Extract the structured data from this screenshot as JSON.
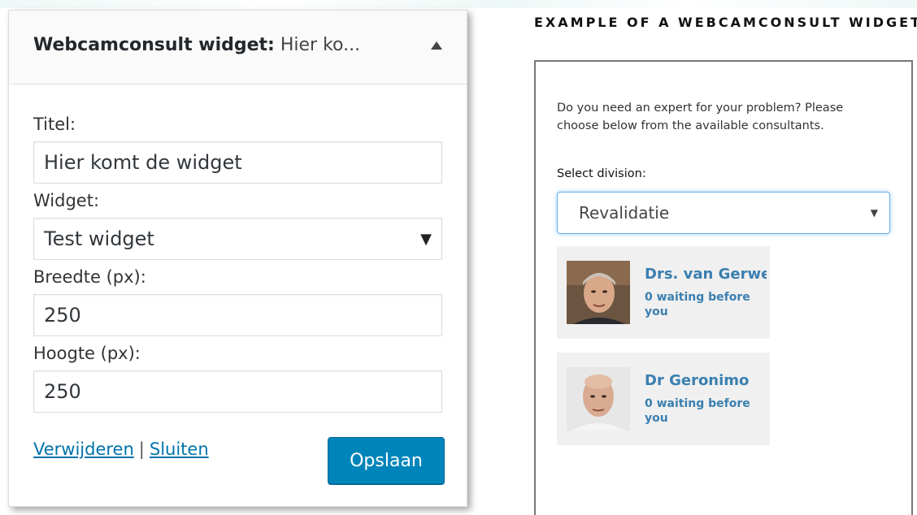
{
  "admin_widget": {
    "title": "Webcamconsult widget:",
    "title_suffix": " Hier ko...",
    "fields": {
      "title_label": "Titel:",
      "title_value": "Hier komt de widget",
      "widget_label": "Widget:",
      "widget_value": "Test widget",
      "width_label": "Breedte (px):",
      "width_value": "250",
      "height_label": "Hoogte (px):",
      "height_value": "250"
    },
    "actions": {
      "delete_label": "Verwijderen",
      "separator": "|",
      "close_label": "Sluiten",
      "save_label": "Opslaan"
    }
  },
  "example": {
    "heading": "EXAMPLE OF A WEBCAMCONSULT WIDGET",
    "intro": "Do you need an expert for your problem? Please choose below from the available consultants.",
    "select_label": "Select division:",
    "select_value": "Revalidatie",
    "consultants": [
      {
        "name": "Drs. van Gerwen",
        "status": "0 waiting before you"
      },
      {
        "name": "Dr Geronimo",
        "status": "0 waiting before you"
      }
    ]
  },
  "colors": {
    "wp_primary": "#0085ba",
    "link": "#0073aa",
    "consultant_text": "#3a7fb0",
    "focus_border": "#66afe9"
  },
  "icons": [
    "triangle-up-icon",
    "chevron-down-icon",
    "person-photo"
  ]
}
